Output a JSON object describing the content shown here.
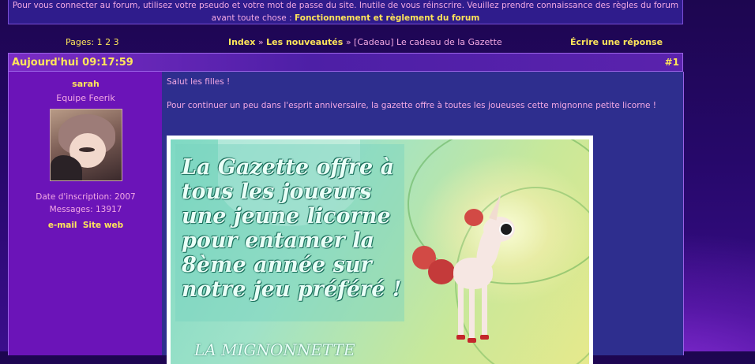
{
  "notice": {
    "text": "Pour vous connecter au forum, utilisez votre pseudo et votre mot de passe du site. Inutile de vous réinscrire. Veuillez prendre connaissance des règles du forum avant toute chose : ",
    "link": "Fonctionnement et règlement du forum"
  },
  "nav": {
    "pages_label": "Pages:",
    "pages": [
      "1",
      "2",
      "3"
    ],
    "crumb_index": "Index",
    "crumb_sep": "»",
    "crumb_section": "Les nouveautés",
    "crumb_topic": "[Cadeau] Le cadeau de la Gazette",
    "reply": "Écrire une réponse"
  },
  "post": {
    "date": "Aujourd'hui 09:17:59",
    "number": "#1",
    "author": {
      "name": "sarah",
      "rank": "Equipe Feerik",
      "joined": "Date d'inscription: 2007",
      "messages": "Messages: 13917",
      "email_link": "e-mail",
      "site_link": "Site web"
    },
    "body": {
      "greeting": "Salut les filles !",
      "text": "Pour continuer un peu dans l'esprit anniversaire, la gazette offre à toutes les joueuses cette mignonne petite licorne !"
    },
    "image": {
      "text_lines": [
        "La Gazette offre à",
        "tous les joueurs",
        "une jeune licorne",
        "pour entamer la",
        "8ème année sur",
        "notre jeu préféré !"
      ],
      "bottom_text": "LA MIGNONNETTE"
    }
  },
  "colors": {
    "link": "#ffe55a",
    "text": "#f3a9e4",
    "author_bg": "#6b14b8",
    "body_bg": "#2e2e8e"
  }
}
